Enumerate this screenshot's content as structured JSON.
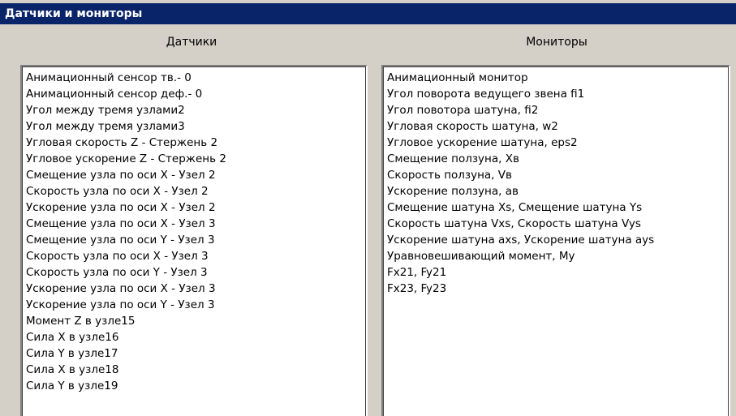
{
  "window": {
    "title": "Датчики и мониторы"
  },
  "sensors": {
    "header": "Датчики",
    "items": [
      "Анимационный сенсор тв.- 0",
      "Анимационный сенсор деф.- 0",
      "Угол между тремя узлами2",
      "Угол между тремя узлами3",
      "Угловая скорость Z - Стержень 2",
      "Угловое ускорение Z - Стержень 2",
      "Смещение узла по оси X - Узел 2",
      "Скорость узла по оси X - Узел 2",
      "Ускорение узла по оси X - Узел 2",
      "Смещение узла по оси X - Узел 3",
      "Смещение узла по оси Y - Узел 3",
      "Скорость узла по оси X - Узел 3",
      "Скорость узла по оси Y - Узел 3",
      "Ускорение узла по оси X - Узел 3",
      "Ускорение узла по оси Y - Узел 3",
      "Момент Z в узле15",
      "Сила X в узле16",
      "Сила Y в узле17",
      "Сила X в узле18",
      "Сила Y в узле19"
    ]
  },
  "monitors": {
    "header": "Мониторы",
    "items": [
      "Анимационный монитор",
      "Угол поворота ведущего звена fi1",
      "Угол повотора шатуна, fi2",
      "Угловая скорость шатуна, w2",
      "Угловое ускорение шатуна, eps2",
      "Смещение ползуна, Xв",
      "Скорость ползуна, Vв",
      "Ускорение ползуна, aв",
      "Смещение шатуна Xs, Смещение шатуна Ys",
      "Скорость шатуна Vxs, Скорость шатуна Vys",
      "Ускорение шатуна axs, Ускорение шатуна ays",
      "Уравновешивающий момент, Mу",
      "Fx21, Fy21",
      "Fx23, Fy23"
    ]
  }
}
